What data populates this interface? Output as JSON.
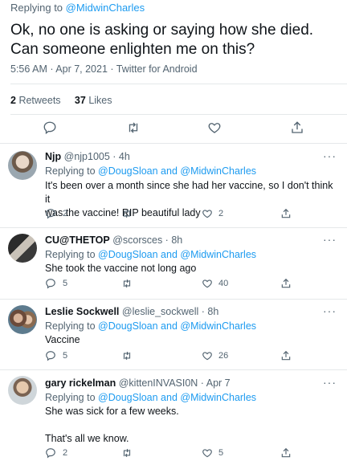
{
  "tweet": {
    "replying_to_prefix": "Replying to",
    "replying_to_handle": "@MidwinCharles",
    "text_line1": "Ok, no one is asking or saying how she died.",
    "text_line2": "Can someone enlighten me on this?",
    "meta": "5:56 AM · Apr 7, 2021 · Twitter for Android",
    "retweets_count": "2",
    "retweets_label": "Retweets",
    "likes_count": "37",
    "likes_label": "Likes",
    "action_icons": [
      "reply-icon",
      "retweet-icon",
      "like-icon",
      "share-icon"
    ]
  },
  "replies": [
    {
      "name": "Njp",
      "handle": "@njp1005 · 4h",
      "replying_prefix": "Replying to",
      "replying_handles": "@DougSloan and @MidwinCharles",
      "lines": [
        "It's been over a month since she had her vaccine, so I don't think it",
        "was the vaccine! RIP beautiful lady"
      ],
      "reply_count": "2",
      "retweet_count": "",
      "like_count": "2"
    },
    {
      "name": "CU@THETOP",
      "handle": "@scorsces · 8h",
      "replying_prefix": "Replying to",
      "replying_handles": "@DougSloan and @MidwinCharles",
      "lines": [
        "She took the vaccine not long ago"
      ],
      "reply_count": "5",
      "retweet_count": "",
      "like_count": "40"
    },
    {
      "name": "Leslie Sockwell",
      "handle": "@leslie_sockwell · 8h",
      "replying_prefix": "Replying to",
      "replying_handles": "@DougSloan and @MidwinCharles",
      "lines": [
        "Vaccine"
      ],
      "reply_count": "5",
      "retweet_count": "",
      "like_count": "26"
    },
    {
      "name": "gary rickelman",
      "handle": "@kittenINVASI0N · Apr 7",
      "replying_prefix": "Replying to",
      "replying_handles": "@DougSloan and @MidwinCharles",
      "lines": [
        "She was sick for a few weeks.",
        "",
        "That's all we know."
      ],
      "reply_count": "2",
      "retweet_count": "",
      "like_count": "5"
    }
  ],
  "more_label": "···",
  "colors": {
    "accent": "#1d9bf0",
    "muted": "#536471",
    "divider": "#e5e8ea"
  }
}
